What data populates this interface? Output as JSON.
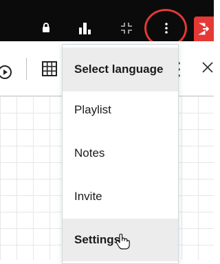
{
  "topbar": {
    "icons": [
      "lock-icon",
      "bar-chart-icon",
      "collapse-icon",
      "more-vertical-icon",
      "exit-icon"
    ],
    "accent": "#e53935",
    "background": "#0b0b0b"
  },
  "toolbar": {
    "icons": [
      "play-icon",
      "grid-icon",
      "more-vertical-icon",
      "close-icon"
    ]
  },
  "menu": {
    "items": [
      {
        "label": "Select language"
      },
      {
        "label": "Playlist"
      },
      {
        "label": "Notes"
      },
      {
        "label": "Invite"
      },
      {
        "label": "Settings"
      }
    ],
    "hover_background": "#ececec"
  }
}
